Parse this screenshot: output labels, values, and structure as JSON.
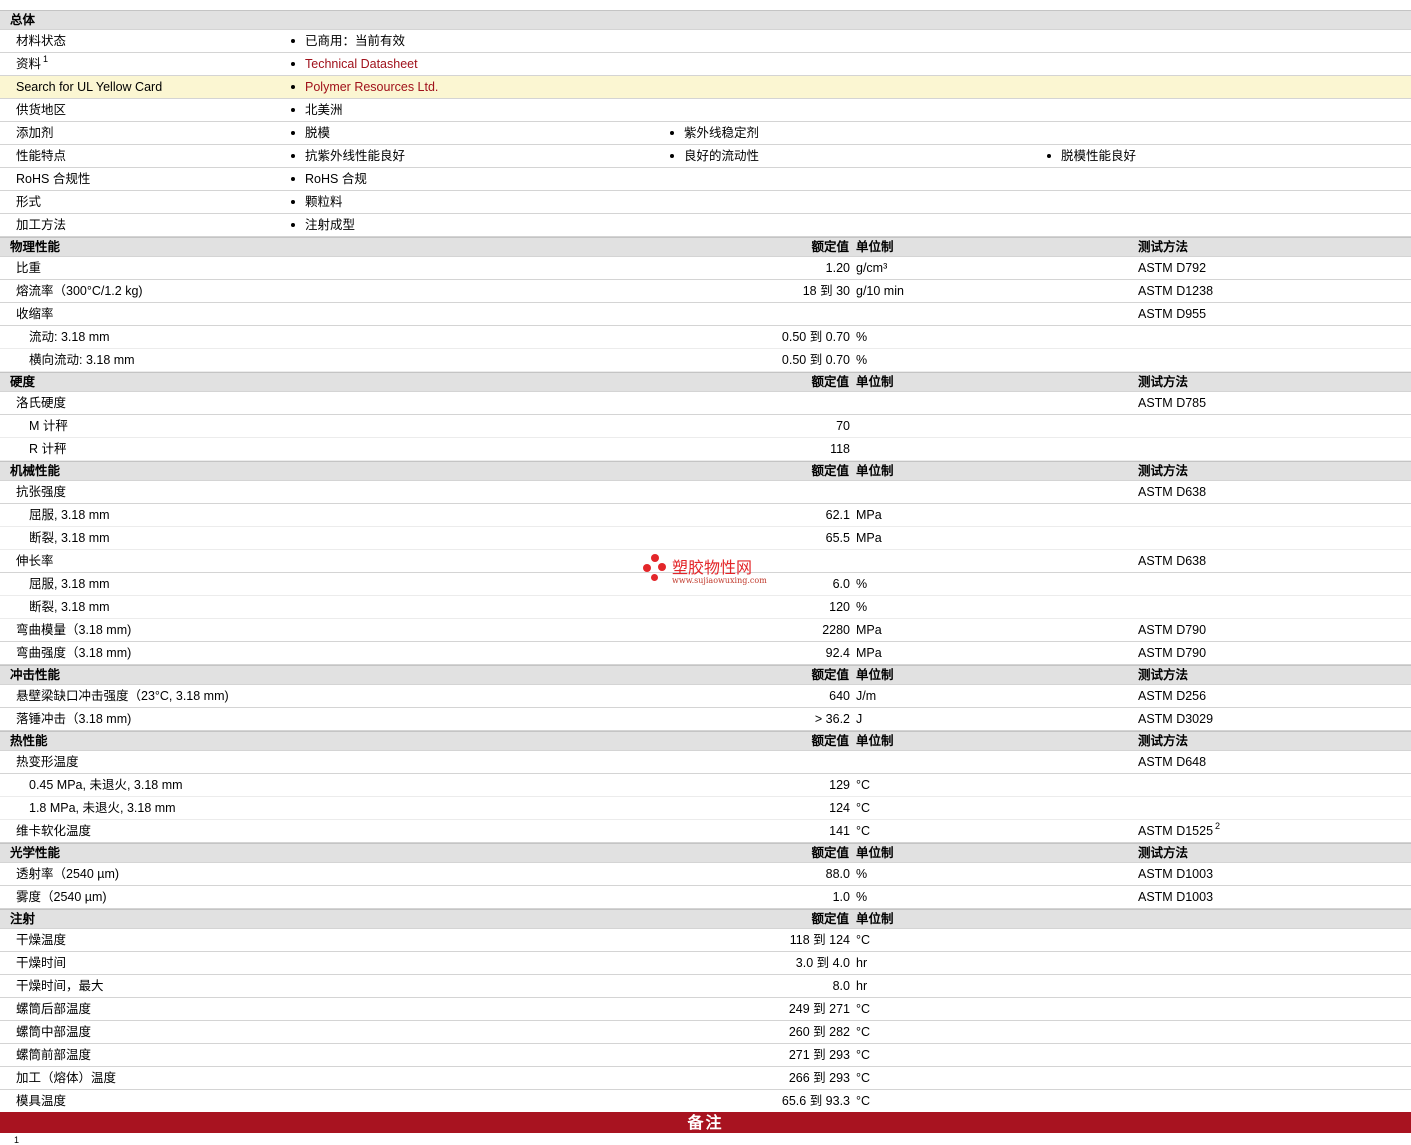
{
  "general": {
    "title": "总体",
    "rows": [
      {
        "label": "材料状态",
        "bullets": [
          "已商用：当前有效"
        ]
      },
      {
        "label": "资料",
        "sup": "1",
        "bullets": [
          "Technical Datasheet"
        ],
        "link": true
      },
      {
        "label": "Search for UL Yellow Card",
        "bullets": [
          "Polymer Resources Ltd."
        ],
        "link": true,
        "highlight": true
      },
      {
        "label": "供货地区",
        "bullets": [
          "北美洲"
        ]
      },
      {
        "label": "添加剂",
        "bullets": [
          "脱模",
          "紫外线稳定剂"
        ]
      },
      {
        "label": "性能特点",
        "bullets": [
          "抗紫外线性能良好",
          "良好的流动性",
          "脱模性能良好"
        ]
      },
      {
        "label": "RoHS 合规性",
        "bullets": [
          "RoHS 合规"
        ]
      },
      {
        "label": "形式",
        "bullets": [
          "颗粒料"
        ]
      },
      {
        "label": "加工方法",
        "bullets": [
          "注射成型"
        ]
      }
    ]
  },
  "sections": [
    {
      "title": "物理性能",
      "h_value": "额定值",
      "h_unit": "单位制",
      "h_test": "测试方法",
      "rows": [
        {
          "label": "比重",
          "value": "1.20",
          "unit": "g/cm³",
          "test": "ASTM D792"
        },
        {
          "label": "熔流率（300°C/1.2 kg)",
          "value": "18 到  30",
          "unit": "g/10 min",
          "test": "ASTM D1238"
        },
        {
          "label": "收缩率",
          "test": "ASTM D955"
        },
        {
          "label": "流动: 3.18 mm",
          "value": "0.50 到  0.70",
          "unit": "%",
          "sub": true
        },
        {
          "label": "横向流动: 3.18 mm",
          "value": "0.50 到  0.70",
          "unit": "%",
          "sub": true
        }
      ]
    },
    {
      "title": "硬度",
      "h_value": "额定值",
      "h_unit": "单位制",
      "h_test": "测试方法",
      "rows": [
        {
          "label": "洛氏硬度",
          "test": "ASTM D785"
        },
        {
          "label": "M 计秤",
          "value": "70",
          "sub": true
        },
        {
          "label": "R 计秤",
          "value": "118",
          "sub": true
        }
      ]
    },
    {
      "title": "机械性能",
      "h_value": "额定值",
      "h_unit": "单位制",
      "h_test": "测试方法",
      "rows": [
        {
          "label": "抗张强度",
          "test": "ASTM D638"
        },
        {
          "label": "屈服, 3.18 mm",
          "value": "62.1",
          "unit": "MPa",
          "sub": true
        },
        {
          "label": "断裂, 3.18 mm",
          "value": "65.5",
          "unit": "MPa",
          "sub": true
        },
        {
          "label": "伸长率",
          "test": "ASTM D638"
        },
        {
          "label": "屈服, 3.18 mm",
          "value": "6.0",
          "unit": "%",
          "sub": true
        },
        {
          "label": "断裂, 3.18 mm",
          "value": "120",
          "unit": "%",
          "sub": true
        },
        {
          "label": "弯曲模量（3.18 mm)",
          "value": "2280",
          "unit": "MPa",
          "test": "ASTM D790"
        },
        {
          "label": "弯曲强度（3.18 mm)",
          "value": "92.4",
          "unit": "MPa",
          "test": "ASTM D790"
        }
      ]
    },
    {
      "title": "冲击性能",
      "h_value": "额定值",
      "h_unit": "单位制",
      "h_test": "测试方法",
      "rows": [
        {
          "label": "悬壁梁缺口冲击强度（23°C, 3.18 mm)",
          "value": "640",
          "unit": "J/m",
          "test": "ASTM D256"
        },
        {
          "label": "落锤冲击（3.18 mm)",
          "value": "> 36.2",
          "unit": "J",
          "test": "ASTM D3029"
        }
      ]
    },
    {
      "title": "热性能",
      "h_value": "额定值",
      "h_unit": "单位制",
      "h_test": "测试方法",
      "rows": [
        {
          "label": "热变形温度",
          "test": "ASTM D648"
        },
        {
          "label": "0.45 MPa, 未退火, 3.18 mm",
          "value": "129",
          "unit": "°C",
          "sub": true
        },
        {
          "label": "1.8 MPa, 未退火, 3.18 mm",
          "value": "124",
          "unit": "°C",
          "sub": true
        },
        {
          "label": "维卡软化温度",
          "value": "141",
          "unit": "°C",
          "test": "ASTM D1525",
          "test_sup": "2"
        }
      ]
    },
    {
      "title": "光学性能",
      "h_value": "额定值",
      "h_unit": "单位制",
      "h_test": "测试方法",
      "rows": [
        {
          "label": "透射率（2540 µm)",
          "value": "88.0",
          "unit": "%",
          "test": "ASTM D1003"
        },
        {
          "label": "雾度（2540 µm)",
          "value": "1.0",
          "unit": "%",
          "test": "ASTM D1003"
        }
      ]
    },
    {
      "title": "注射",
      "h_value": "额定值",
      "h_unit": "单位制",
      "h_test": "",
      "rows": [
        {
          "label": "干燥温度",
          "value": "118 到  124",
          "unit": "°C"
        },
        {
          "label": "干燥时间",
          "value": "3.0 到  4.0",
          "unit": "hr"
        },
        {
          "label": "干燥时间，最大",
          "value": "8.0",
          "unit": "hr"
        },
        {
          "label": "螺筒后部温度",
          "value": "249 到  271",
          "unit": "°C"
        },
        {
          "label": "螺筒中部温度",
          "value": "260 到  282",
          "unit": "°C"
        },
        {
          "label": "螺筒前部温度",
          "value": "271 到  293",
          "unit": "°C"
        },
        {
          "label": "加工（熔体）温度",
          "value": "266 到  293",
          "unit": "°C"
        },
        {
          "label": "模具温度",
          "value": "65.6 到  93.3",
          "unit": "°C"
        }
      ]
    }
  ],
  "notes": {
    "title": "备注",
    "footnote_marker": "1"
  },
  "watermark": {
    "name": "塑胶物性网",
    "url": "www.sujiaowuxing.com",
    "color": "#e3262a"
  }
}
